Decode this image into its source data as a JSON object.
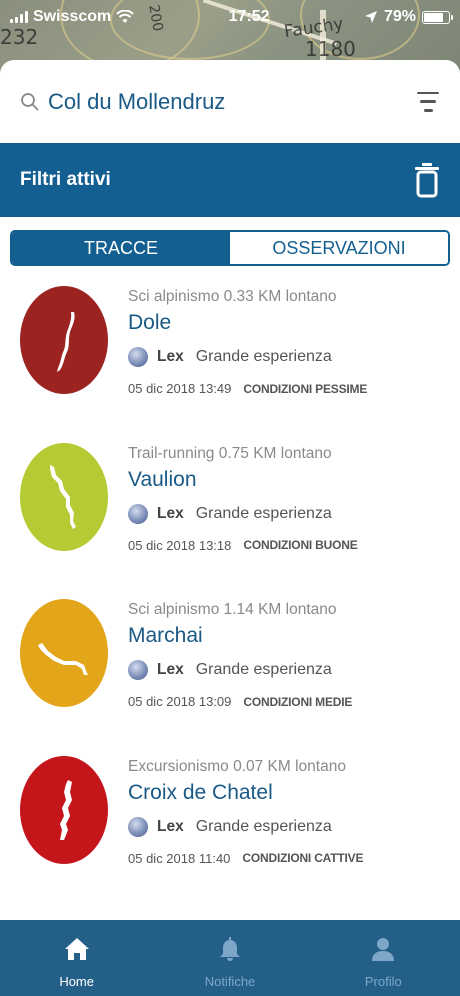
{
  "status_bar": {
    "carrier": "Swisscom",
    "time": "17:52",
    "battery_percent": "79%",
    "battery_level": 0.79,
    "icons": [
      "signal-icon",
      "wifi-icon",
      "location-arrow-icon",
      "battery-icon"
    ]
  },
  "map": {
    "labels": [
      "232",
      "200",
      "Fauchy",
      "1180"
    ]
  },
  "search": {
    "value": "Col du Mollendruz",
    "icon": "search-icon",
    "filter_icon": "filter-icon"
  },
  "filter_bar": {
    "title": "Filtri attivi",
    "icon": "trash-icon",
    "color": "#135f91"
  },
  "tabs": [
    {
      "label": "TRACCE",
      "active": true
    },
    {
      "label": "OSSERVAZIONI",
      "active": false
    }
  ],
  "items": [
    {
      "meta": "Sci alpinismo 0.33 KM lontano",
      "name": "Dole",
      "user": "Lex",
      "experience": "Grande esperienza",
      "date": "05 dic 2018 13:49",
      "condition": "CONDIZIONI PESSIME",
      "color": "#9c2420"
    },
    {
      "meta": "Trail-running 0.75 KM lontano",
      "name": "Vaulion",
      "user": "Lex",
      "experience": "Grande esperienza",
      "date": "05 dic 2018 13:18",
      "condition": "CONDIZIONI BUONE",
      "color": "#b6cb33"
    },
    {
      "meta": "Sci alpinismo 1.14 KM lontano",
      "name": "Marchai",
      "user": "Lex",
      "experience": "Grande esperienza",
      "date": "05 dic 2018 13:09",
      "condition": "CONDIZIONI MEDIE",
      "color": "#e3a519"
    },
    {
      "meta": "Excursionismo 0.07 KM lontano",
      "name": "Croix de Chatel",
      "user": "Lex",
      "experience": "Grande esperienza",
      "date": "05 dic 2018 11:40",
      "condition": "CONDIZIONI CATTIVE",
      "color": "#c4151b"
    }
  ],
  "bottom_nav": [
    {
      "label": "Home",
      "icon": "home-icon",
      "active": true
    },
    {
      "label": "Notifiche",
      "icon": "bell-icon",
      "active": false
    },
    {
      "label": "Profilo",
      "icon": "user-icon",
      "active": false
    }
  ]
}
